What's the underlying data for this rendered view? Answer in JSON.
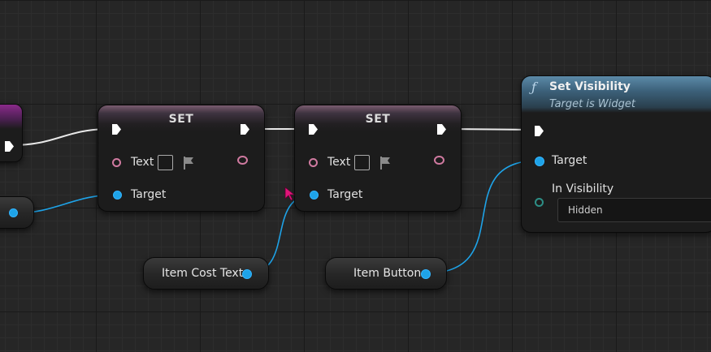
{
  "canvas": {
    "background": "#262626",
    "wire_exec_color": "#e8e8e8",
    "wire_object_color": "#1ea3e8"
  },
  "set_nodes": [
    {
      "title": "SET",
      "text_pin_label": "Text",
      "target_pin_label": "Target"
    },
    {
      "title": "SET",
      "text_pin_label": "Text",
      "target_pin_label": "Target"
    }
  ],
  "variable_nodes": [
    {
      "label": "Item Cost Text"
    },
    {
      "label": "Item Button"
    }
  ],
  "function_node": {
    "icon": "function-icon",
    "title": "Set Visibility",
    "subtitle": "Target is Widget",
    "target_pin_label": "Target",
    "in_visibility_label": "In Visibility",
    "in_visibility_value": "Hidden",
    "header_color": "#3c617a"
  },
  "colors": {
    "set_header": "#7a5c70",
    "text_pin": "#d07aa0",
    "object_pin": "#1ea3e8",
    "enum_pin": "#2d8f86"
  }
}
